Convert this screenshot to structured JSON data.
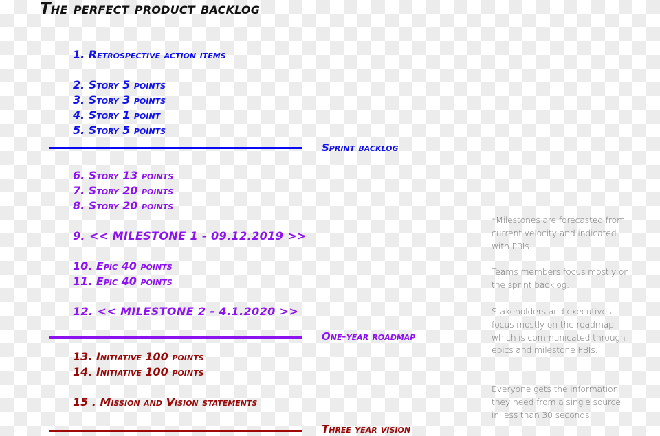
{
  "title": "The perfect product backlog",
  "colors": {
    "sprint": "#1010e8",
    "roadmap": "#8c12f0",
    "vision": "#960a0a",
    "notes": "#6f6f6f"
  },
  "items": [
    {
      "text": "1. Retrospective action items",
      "section": "sprint"
    },
    {
      "text": "2. Story 5 points",
      "section": "sprint"
    },
    {
      "text": "3. Story 3 points",
      "section": "sprint"
    },
    {
      "text": "4. Story 1 point",
      "section": "sprint"
    },
    {
      "text": "5. Story 5 points",
      "section": "sprint"
    },
    {
      "text": "6. Story 13 points",
      "section": "roadmap"
    },
    {
      "text": "7. Story 20 points",
      "section": "roadmap"
    },
    {
      "text": "8. Story 20 points",
      "section": "roadmap"
    },
    {
      "text": "9. << MILESTONE 1 - 09.12.2019 >>",
      "section": "roadmap"
    },
    {
      "text": "10. Epic 40 points",
      "section": "roadmap"
    },
    {
      "text": "11. Epic 40 points",
      "section": "roadmap"
    },
    {
      "text": "12. << MILESTONE 2 - 4.1.2020 >>",
      "section": "roadmap"
    },
    {
      "text": "13. Initiative 100 points",
      "section": "vision"
    },
    {
      "text": "14. Initiative 100 points",
      "section": "vision"
    },
    {
      "text": "15 . Mission and Vision statements",
      "section": "vision"
    }
  ],
  "sections": {
    "sprint": "Sprint backlog",
    "roadmap": "One-year roadmap",
    "vision": "Three year vision"
  },
  "notes": [
    "*Milestones are forecasted from current velocity and indicated with PBIs.",
    "Teams members focus mostly on the sprint backlog.",
    "Stakeholders and executives focus mostly on the roadmap which is communicated through epics and milestone PBIs.",
    "Everyone gets the information they need from a single source in less than 30 seconds."
  ]
}
